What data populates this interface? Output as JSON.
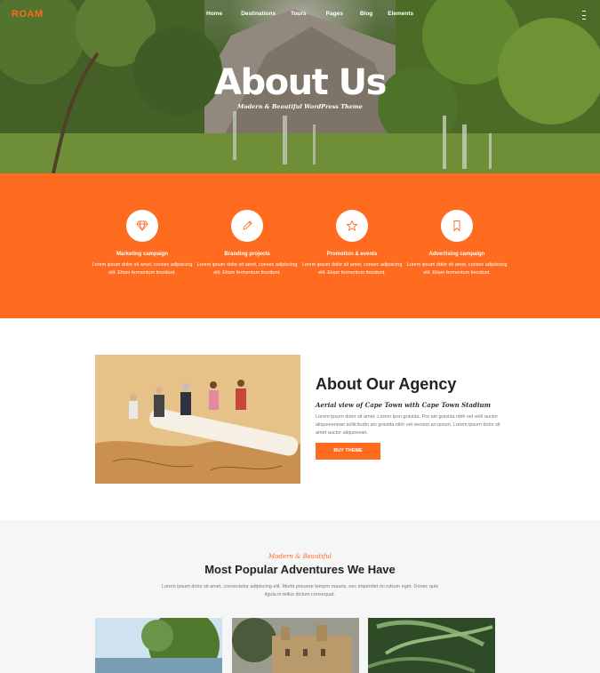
{
  "brand": {
    "logo": "ROAM",
    "accent": "#ff6b1f"
  },
  "nav": {
    "items": [
      "Home",
      "Destinations",
      "Tours",
      "Pages",
      "Blog",
      "Elements"
    ]
  },
  "hero": {
    "title": "About Us",
    "subtitle": "Modern & Beautiful WordPress Theme"
  },
  "features": [
    {
      "icon": "diamond-icon",
      "title": "Marketing campaign",
      "text": "Lorem ipsum dolor sit amet, consec adipiscing elit. Etiam fermentum tincidunt."
    },
    {
      "icon": "pencil-icon",
      "title": "Branding projects",
      "text": "Lorem ipsum dolor sit amet, consec adipiscing elit. Etiam fermentum tincidunt."
    },
    {
      "icon": "star-icon",
      "title": "Promotion & events",
      "text": "Lorem ipsum dolor sit amet, consec adipiscing elit. Etiam fermentum tincidunt."
    },
    {
      "icon": "bookmark-icon",
      "title": "Advertising campaign",
      "text": "Lorem ipsum dolor sit amet, consec adipiscing elit. Etiam fermentum tincidunt."
    }
  ],
  "about": {
    "title": "About Our Agency",
    "subtitle": "Aerial view of Cape Town with Cape Town Stadium",
    "text": "Lorem ipsum dolor sit amet. Lorem Ipsn gravida. Pro ain gravida nibh vel velit auctor aliqueeenean sollicitudin ain gravida nibh vel version an ipsum. Lorem ipsum dolor sit amet auctor aliqueeean.",
    "button": "BUY THEME"
  },
  "adventures": {
    "kicker": "Modern & Beautiful",
    "title": "Most Popular Adventures We Have",
    "text": "Lorem ipsum dolor sit amet, consectetur adipiscing elit. Morbi posuere tempor mauris, nec imperdiet mi rutrum eget. Donec quis ligula in tellus dictum consequat."
  }
}
